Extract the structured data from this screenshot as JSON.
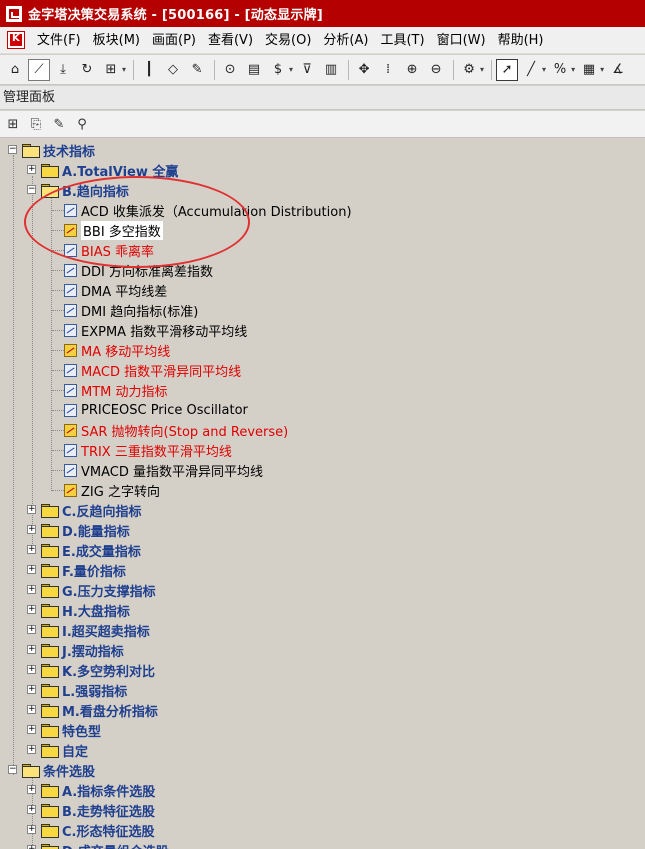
{
  "window": {
    "title": "金字塔决策交易系统 - [500166] - [动态显示牌]"
  },
  "menubar": {
    "items": [
      "文件(F)",
      "板块(M)",
      "画面(P)",
      "查看(V)",
      "交易(O)",
      "分析(A)",
      "工具(T)",
      "窗口(W)",
      "帮助(H)"
    ]
  },
  "panel": {
    "title": "管理面板"
  },
  "tree": {
    "root1": "技术指标",
    "cat_a": "A.TotalView 全赢",
    "cat_b": "B.趋向指标",
    "items": [
      {
        "label": "ACD 收集派发（Accumulation Distribution)",
        "style": "norm",
        "icon": "indicator-icon"
      },
      {
        "label": "BBI 多空指数",
        "style": "hl",
        "icon": "favorite-indicator-icon"
      },
      {
        "label": "BIAS 乖离率",
        "style": "red",
        "icon": "indicator-icon"
      },
      {
        "label": "DDI 方向标准离差指数",
        "style": "norm",
        "icon": "indicator-icon"
      },
      {
        "label": "DMA 平均线差",
        "style": "norm",
        "icon": "indicator-icon"
      },
      {
        "label": "DMI 趋向指标(标准)",
        "style": "norm",
        "icon": "indicator-icon"
      },
      {
        "label": "EXPMA 指数平滑移动平均线",
        "style": "norm",
        "icon": "indicator-icon"
      },
      {
        "label": "MA 移动平均线",
        "style": "red",
        "icon": "favorite-indicator-icon"
      },
      {
        "label": "MACD 指数平滑异同平均线",
        "style": "red",
        "icon": "indicator-icon"
      },
      {
        "label": "MTM 动力指标",
        "style": "red",
        "icon": "indicator-icon"
      },
      {
        "label": "PRICEOSC Price Oscillator",
        "style": "norm",
        "icon": "indicator-icon"
      },
      {
        "label": "SAR 抛物转向(Stop and Reverse)",
        "style": "red",
        "icon": "favorite-indicator-icon"
      },
      {
        "label": "TRIX 三重指数平滑平均线",
        "style": "red",
        "icon": "indicator-icon"
      },
      {
        "label": "VMACD 量指数平滑异同平均线",
        "style": "norm",
        "icon": "indicator-icon"
      },
      {
        "label": "ZIG 之字转向",
        "style": "norm",
        "icon": "favorite-indicator-icon"
      }
    ],
    "categories": [
      "C.反趋向指标",
      "D.能量指标",
      "E.成交量指标",
      "F.量价指标",
      "G.压力支撑指标",
      "H.大盘指标",
      "I.超买超卖指标",
      "J.摆动指标",
      "K.多空势利对比",
      "L.强弱指标",
      "M.看盘分析指标",
      "特色型",
      "自定"
    ],
    "root2": "条件选股",
    "root2_categories": [
      "A.指标条件选股",
      "B.走势特征选股",
      "C.形态特征选股",
      "D.成交量组合选股"
    ]
  },
  "colors": {
    "titlebar": "#b40000",
    "category_text": "#1f3f8f",
    "red_item": "#e00000",
    "annotation": "#e03030"
  }
}
